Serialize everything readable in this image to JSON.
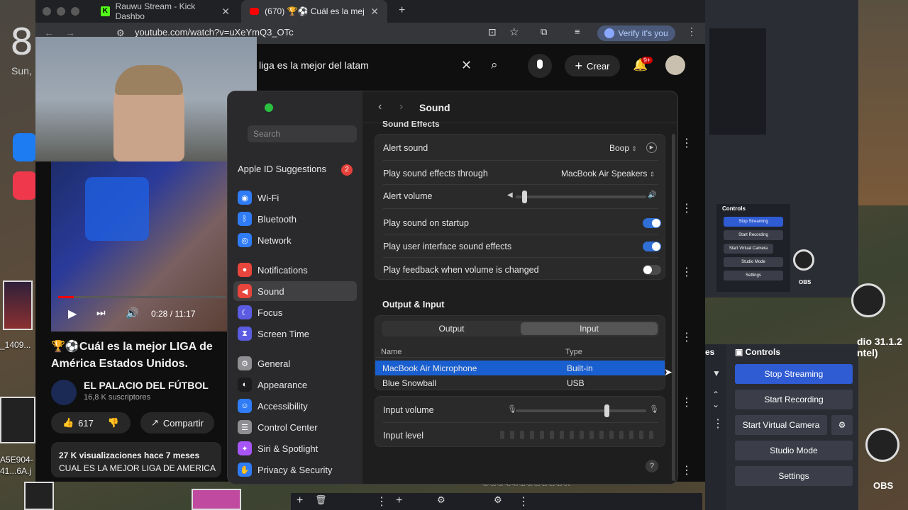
{
  "desktop": {
    "clock": "8",
    "date": "Sun,",
    "files": [
      "_1409...",
      "A5E904-",
      "41...6A.j"
    ]
  },
  "browser": {
    "tabs": [
      {
        "title": "Rauwu Stream - Kick Dashbo",
        "icon": "kick-icon"
      },
      {
        "title": "(670) 🏆⚽ Cuál es la mejor L",
        "icon": "youtube-icon"
      }
    ],
    "url": "youtube.com/watch?v=uXeYmQ3_OTc",
    "verify_label": "Verify it's you"
  },
  "youtube": {
    "search_value": "liga es la mejor del latam",
    "create_label": "Crear",
    "notif_count": "9+",
    "video_time": "0:28 / 11:17",
    "progress_fraction": 0.092,
    "title": "🏆⚽Cuál es la mejor LIGA de América Estados Unidos.",
    "channel": "EL PALACIO DEL FÚTBOL",
    "subscribers": "16,8 K suscriptores",
    "likes": "617",
    "share_label": "Compartir",
    "views": "27 K visualizaciones  hace 7 meses",
    "desc_line": "CUAL ES LA MEJOR LIGA DE AMERICA"
  },
  "settings": {
    "window_title": "Sound",
    "search_placeholder": "Search",
    "apple_id": {
      "label": "Apple ID Suggestions",
      "badge": "2"
    },
    "sidebar": [
      {
        "label": "Wi-Fi",
        "icon": "wifi-icon",
        "color": "#2f7cf6"
      },
      {
        "label": "Bluetooth",
        "icon": "bluetooth-icon",
        "color": "#2f7cf6"
      },
      {
        "label": "Network",
        "icon": "globe-icon",
        "color": "#2f7cf6"
      },
      {
        "label": "Notifications",
        "icon": "bell-icon",
        "color": "#e8453c"
      },
      {
        "label": "Sound",
        "icon": "speaker-icon",
        "color": "#e8453c"
      },
      {
        "label": "Focus",
        "icon": "moon-icon",
        "color": "#5b5ce2"
      },
      {
        "label": "Screen Time",
        "icon": "hourglass-icon",
        "color": "#5b5ce2"
      },
      {
        "label": "General",
        "icon": "gear-icon",
        "color": "#8e8e93"
      },
      {
        "label": "Appearance",
        "icon": "appearance-icon",
        "color": "#1c1c1e"
      },
      {
        "label": "Accessibility",
        "icon": "accessibility-icon",
        "color": "#2f7cf6"
      },
      {
        "label": "Control Center",
        "icon": "control-center-icon",
        "color": "#8e8e93"
      },
      {
        "label": "Siri & Spotlight",
        "icon": "siri-icon",
        "color": "#a855f7"
      },
      {
        "label": "Privacy & Security",
        "icon": "hand-icon",
        "color": "#2f7cf6"
      }
    ],
    "sound_effects_header": "Sound Effects",
    "alert_sound": {
      "label": "Alert sound",
      "value": "Boop"
    },
    "play_through": {
      "label": "Play sound effects through",
      "value": "MacBook Air Speakers"
    },
    "alert_volume": {
      "label": "Alert volume",
      "level": 0.05
    },
    "startup": {
      "label": "Play sound on startup",
      "on": true
    },
    "ui_effects": {
      "label": "Play user interface sound effects",
      "on": true
    },
    "feedback": {
      "label": "Play feedback when volume is changed",
      "on": false
    },
    "output_input_header": "Output & Input",
    "seg_output": "Output",
    "seg_input": "Input",
    "col_name": "Name",
    "col_type": "Type",
    "devices": [
      {
        "name": "MacBook Air Microphone",
        "type": "Built-in",
        "selected": true
      },
      {
        "name": "Blue Snowball",
        "type": "USB",
        "selected": false
      }
    ],
    "input_volume": {
      "label": "Input volume",
      "level": 0.68
    },
    "input_level": {
      "label": "Input level"
    },
    "help": "?"
  },
  "obs": {
    "mini_controls": "Controls",
    "mini_buttons": [
      "Stop Streaming",
      "Start Recording",
      "Start Virtual Camera",
      "Studio Mode",
      "Settings"
    ],
    "version_small": "udio 31.1.2\nntel)",
    "version": "dio 31.1.2",
    "version2": "ntel)",
    "controls_header": "Controls",
    "tab_s": "es",
    "buttons": [
      "Stop Streaming",
      "Start Recording",
      "Start Virtual Camera",
      "Studio Mode",
      "Settings"
    ],
    "logo_label": "OBS",
    "logo_label_small": "OBS",
    "meter_scale": "-60 -55 -50 -45 -40 -35 -30 -25 -20 -15 -10 -5 0"
  }
}
